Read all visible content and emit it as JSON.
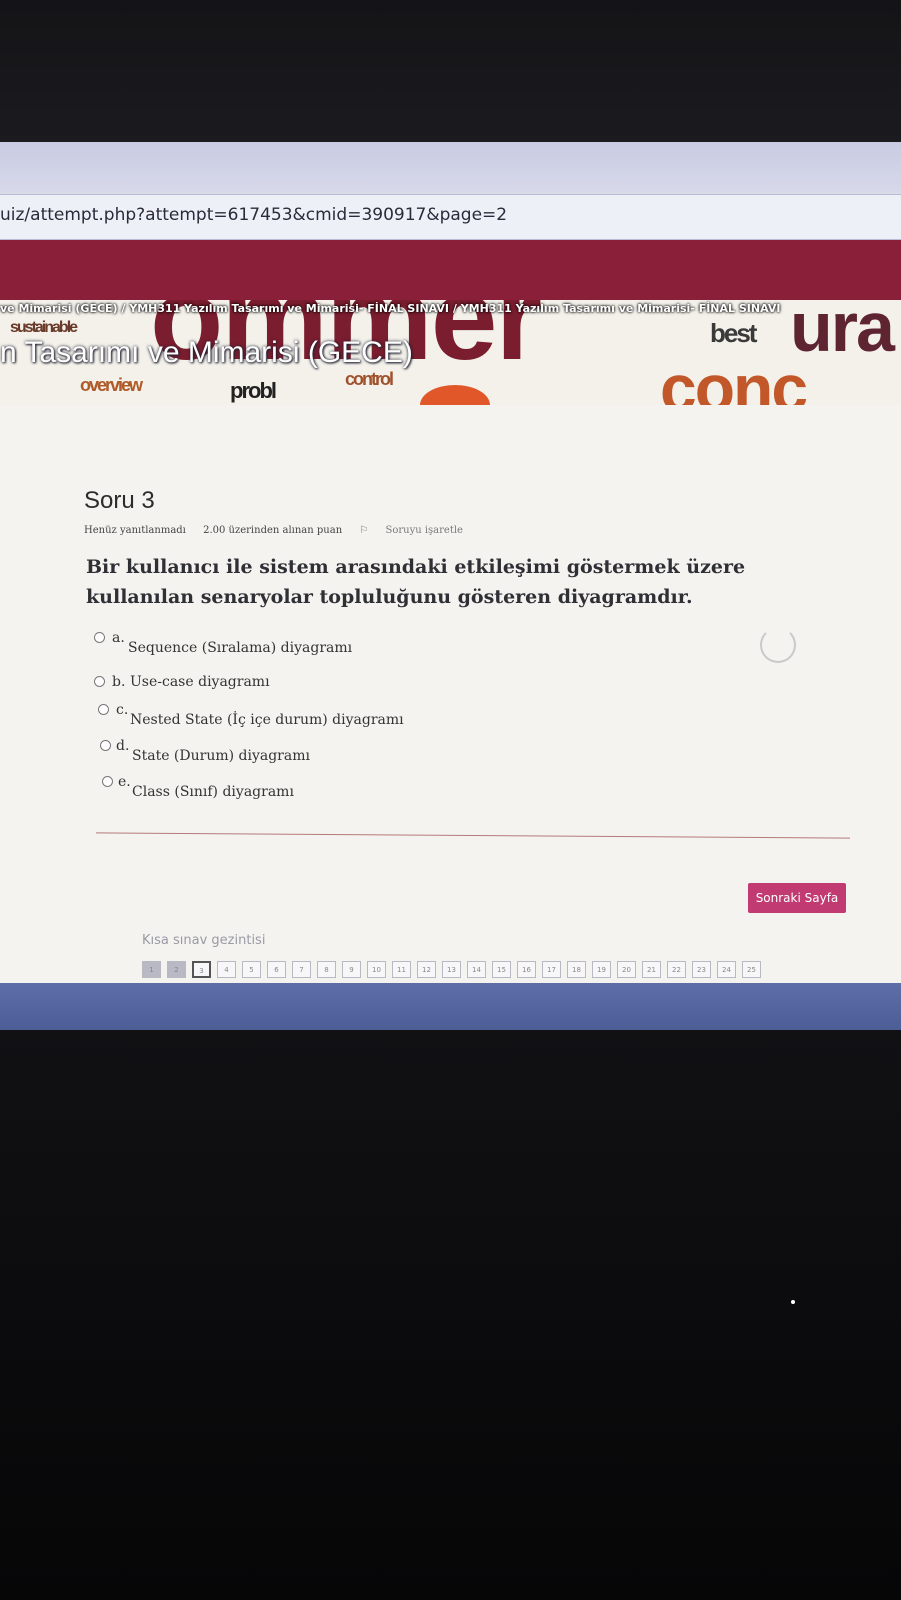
{
  "browser": {
    "url": "uiz/attempt.php?attempt=617453&cmid=390917&page=2"
  },
  "header": {
    "breadcrumb": "ve Mimarisi (GECE)  /  YMH311 Yazılım Tasarımı ve Mimarisi- FİNAL SINAVI  /  YMH311 Yazılım Tasarımı ve Mimarisi- FİNAL SINAVI",
    "course_title": "n Tasarımı ve Mimarisi (GECE)",
    "banner_words": [
      "ommer",
      "ura",
      "conc",
      "best",
      "sustainable",
      "overview",
      "probl",
      "control"
    ]
  },
  "question": {
    "title": "Soru 3",
    "status": "Henüz yanıtlanmadı",
    "points": "2.00 üzerinden alınan puan",
    "flag_label": "Soruyu işaretle",
    "text": "Bir kullanıcı ile sistem arasındaki etkileşimi göstermek üzere kullanılan senaryolar topluluğunu gösteren diyagramdır.",
    "options": [
      {
        "letter": "a.",
        "text": "Sequence (Sıralama) diyagramı"
      },
      {
        "letter": "b.",
        "text": "Use-case diyagramı"
      },
      {
        "letter": "c.",
        "text": "Nested State (İç içe durum) diyagramı"
      },
      {
        "letter": "d.",
        "text": "State (Durum) diyagramı"
      },
      {
        "letter": "e.",
        "text": "Class (Sınıf) diyagramı"
      }
    ]
  },
  "actions": {
    "next_label": "Sonraki Sayfa"
  },
  "navigation": {
    "label": "Kısa sınav gezintisi",
    "pages": [
      "1",
      "2",
      "3",
      "4",
      "5",
      "6",
      "7",
      "8",
      "9",
      "10",
      "11",
      "12",
      "13",
      "14",
      "15",
      "16",
      "17",
      "18",
      "19",
      "20",
      "21",
      "22",
      "23",
      "24",
      "25"
    ],
    "answered": [
      "1",
      "2"
    ],
    "current": "3"
  },
  "colors": {
    "site_bar": "#8a1f3a",
    "button": "#c23a72",
    "taskbar": "#5e6fa8"
  }
}
